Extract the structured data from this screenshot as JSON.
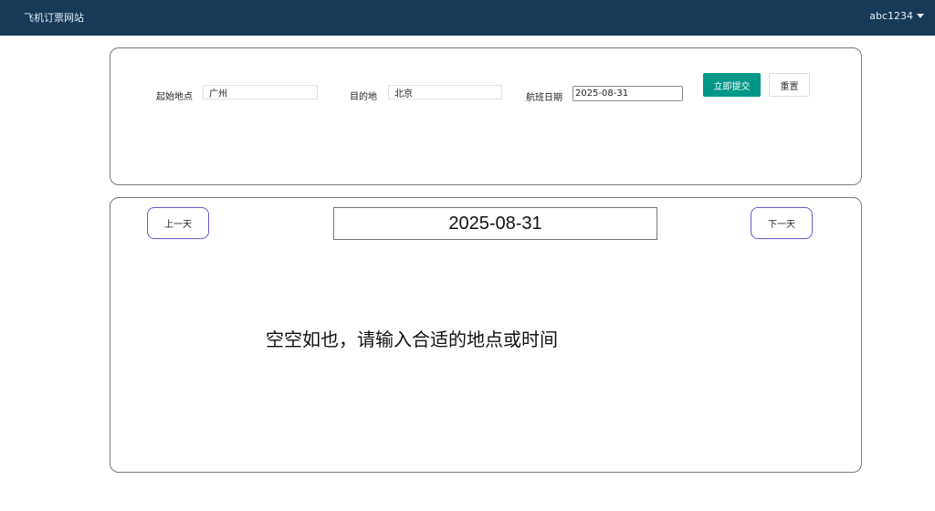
{
  "header": {
    "brand": "飞机订票网站",
    "username": "abc1234"
  },
  "search": {
    "origin_label": "起始地点",
    "origin_value": "广州",
    "destination_label": "目的地",
    "destination_value": "北京",
    "date_label": "航班日期",
    "date_value": "2025-08-31",
    "submit_label": "立即提交",
    "reset_label": "重置"
  },
  "results": {
    "prev_day_label": "上一天",
    "next_day_label": "下一天",
    "current_date": "2025-08-31",
    "empty_message": "空空如也，请输入合适的地点或时间"
  },
  "colors": {
    "header_bg": "#183a58",
    "primary": "#009688",
    "day_button_border": "#6a5acd"
  },
  "icons": {
    "user_menu": "caret-down-icon"
  }
}
